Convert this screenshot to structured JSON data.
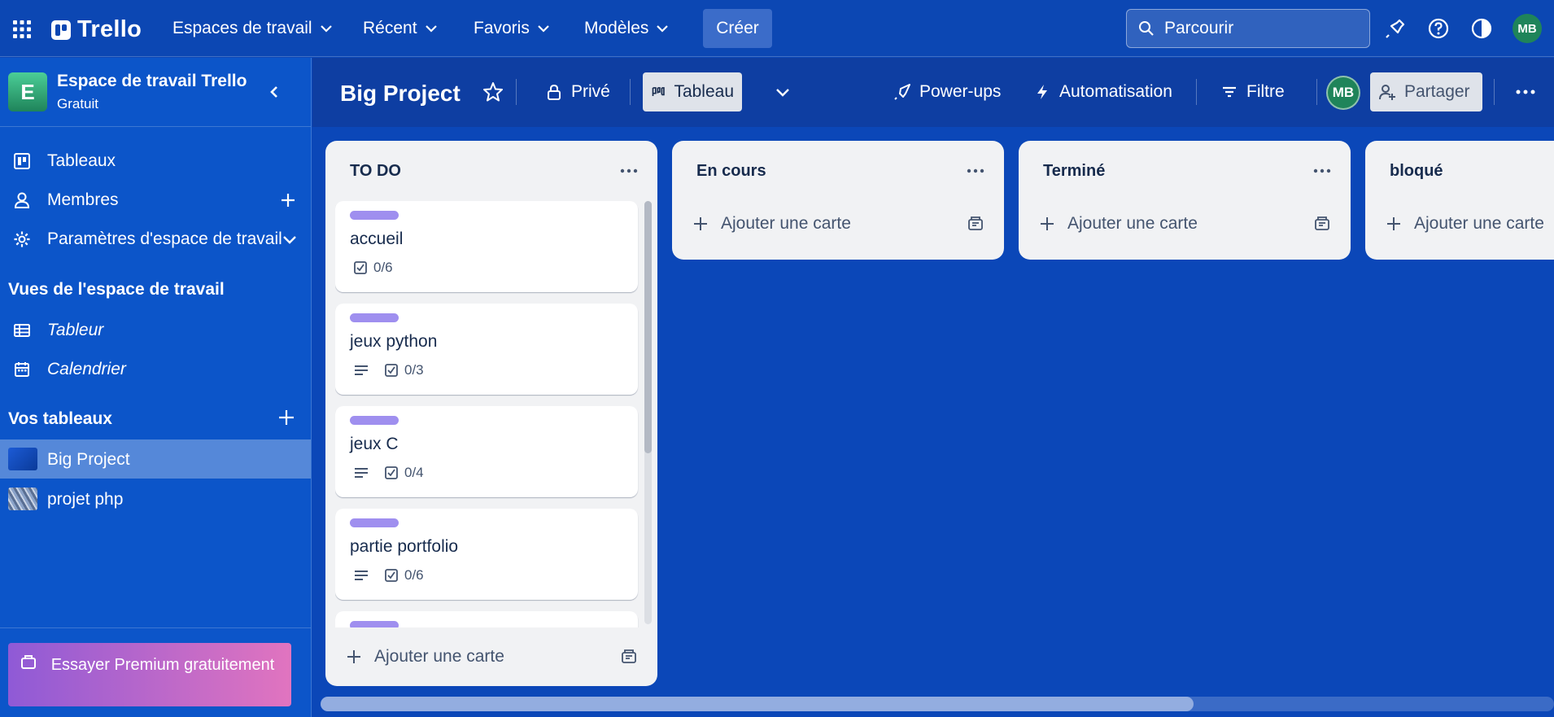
{
  "topnav": {
    "logo": "Trello",
    "menus": [
      "Espaces de travail",
      "Récent",
      "Favoris",
      "Modèles"
    ],
    "create": "Créer",
    "search_placeholder": "Parcourir",
    "avatar": "MB"
  },
  "sidebar": {
    "workspace_name": "Espace de travail Trello",
    "workspace_plan": "Gratuit",
    "workspace_initial": "E",
    "items": [
      "Tableaux",
      "Membres",
      "Paramètres d'espace de travail"
    ],
    "views_heading": "Vues de l'espace de travail",
    "views": [
      "Tableur",
      "Calendrier"
    ],
    "boards_heading": "Vos tableaux",
    "boards": [
      "Big Project",
      "projet php"
    ],
    "premium": "Essayer Premium gratuitement"
  },
  "board": {
    "title": "Big Project",
    "visibility": "Privé",
    "view": "Tableau",
    "powerups": "Power-ups",
    "automation": "Automatisation",
    "filter": "Filtre",
    "member_avatar": "MB",
    "share": "Partager"
  },
  "lists": [
    {
      "title": "TO DO",
      "add_label": "Ajouter une carte",
      "cards": [
        {
          "title": "accueil",
          "description": false,
          "checklist": "0/6"
        },
        {
          "title": "jeux python",
          "description": true,
          "checklist": "0/3"
        },
        {
          "title": "jeux C",
          "description": true,
          "checklist": "0/4"
        },
        {
          "title": "partie portfolio",
          "description": true,
          "checklist": "0/6"
        }
      ]
    },
    {
      "title": "En cours",
      "add_label": "Ajouter une carte"
    },
    {
      "title": "Terminé",
      "add_label": "Ajouter une carte"
    },
    {
      "title": "bloqué",
      "add_label": "Ajouter une carte"
    }
  ],
  "colors": {
    "nav_bg": "#0c47b3",
    "sidebar_bg": "#0c55c9",
    "label_purple": "#9f8fef",
    "list_bg": "#f1f2f4",
    "avatar_green": "#1f845a"
  }
}
